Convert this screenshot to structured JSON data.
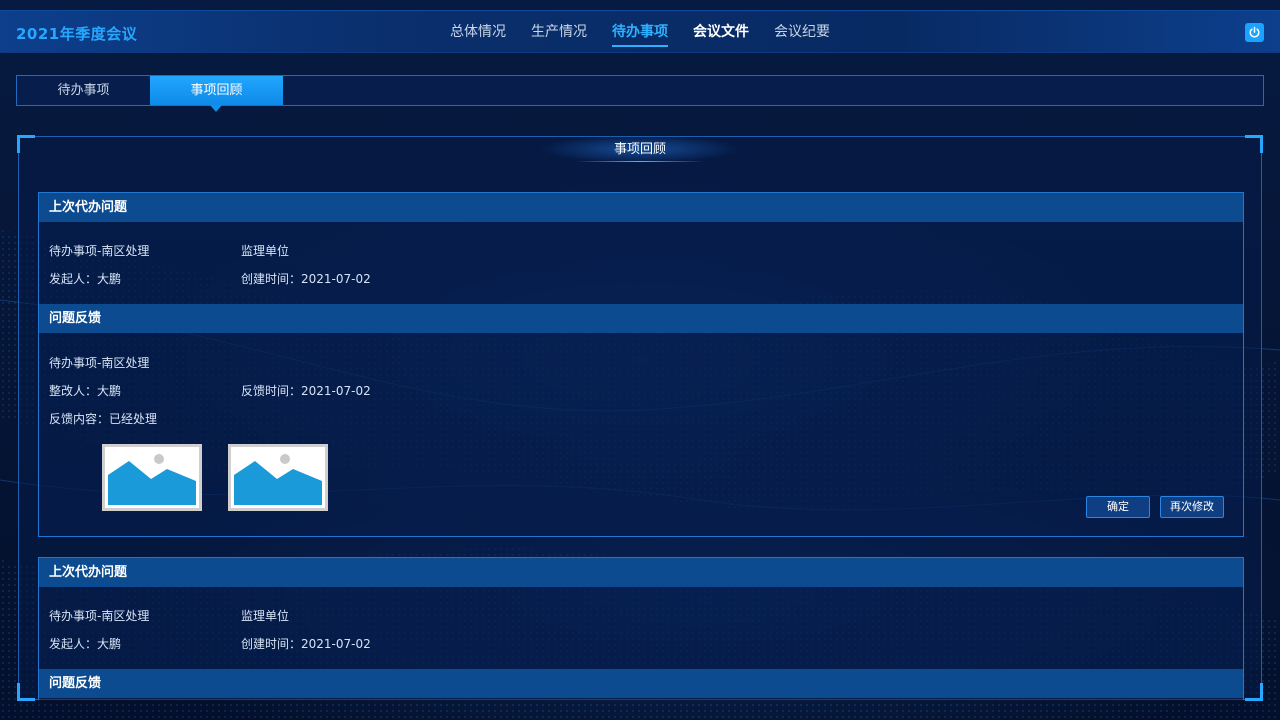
{
  "header": {
    "app_title": "2021年季度会议",
    "nav": [
      "总体情况",
      "生产情况",
      "待办事项",
      "会议文件",
      "会议纪要"
    ],
    "power_icon": "power-icon"
  },
  "subtabs": [
    "待办事项",
    "事项回顾"
  ],
  "panel": {
    "title": "事项回顾"
  },
  "card1": {
    "last_issue": {
      "heading": "上次代办问题",
      "item": "待办事项-南区处理",
      "unit": "监理单位",
      "initiator": "发起人：大鹏",
      "created": "创建时间：2021-07-02"
    },
    "feedback": {
      "heading": "问题反馈",
      "item": "待办事项-南区处理",
      "rectifier": "整改人：大鹏",
      "feedback_time": "反馈时间：2021-07-02",
      "content": "反馈内容：已经处理"
    },
    "buttons": {
      "confirm": "确定",
      "modify": "再次修改"
    }
  },
  "card2": {
    "last_issue": {
      "heading": "上次代办问题",
      "item": "待办事项-南区处理",
      "unit": "监理单位",
      "initiator": "发起人：大鹏",
      "created": "创建时间：2021-07-02"
    },
    "feedback": {
      "heading": "问题反馈"
    }
  },
  "colors": {
    "accent": "#27a7ff",
    "background": "#051536",
    "section_header": "#0c4b8f"
  }
}
